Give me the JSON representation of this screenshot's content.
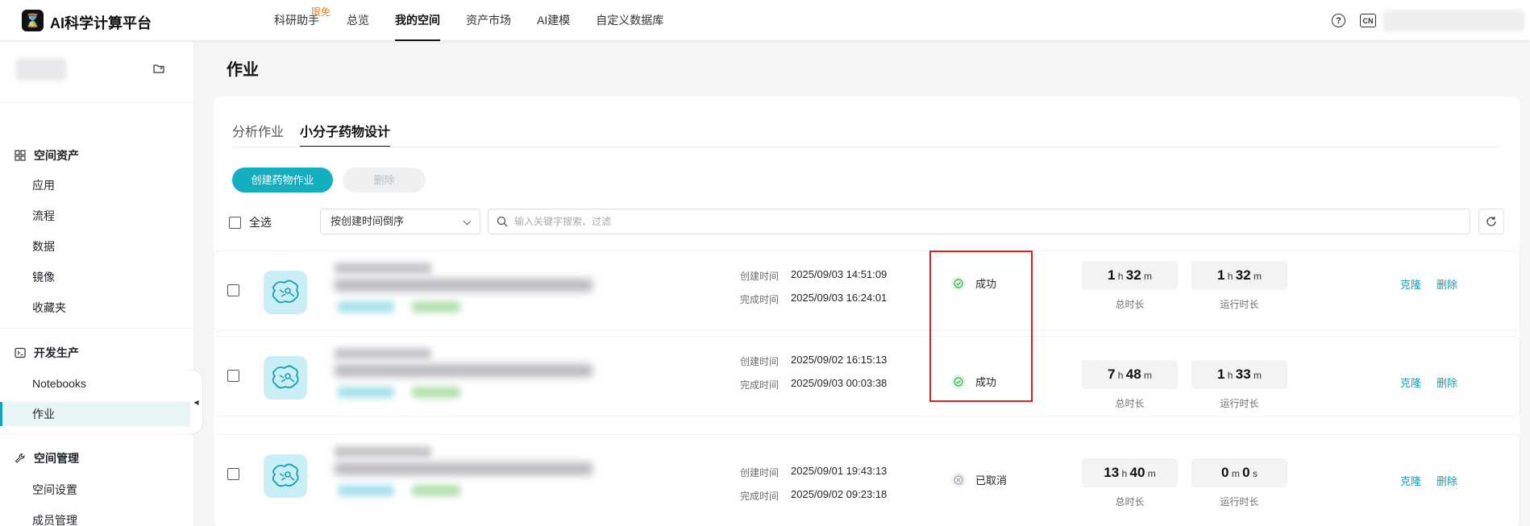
{
  "app": {
    "logo_glyph": "⌛",
    "title": "AI科学计算平台"
  },
  "nav": [
    {
      "label": "科研助手",
      "badge": "限免",
      "active": false
    },
    {
      "label": "总览",
      "active": false
    },
    {
      "label": "我的空间",
      "active": true
    },
    {
      "label": "资产市场",
      "active": false
    },
    {
      "label": "AI建模",
      "active": false
    },
    {
      "label": "自定义数据库",
      "active": false
    }
  ],
  "header": {
    "help_glyph": "?",
    "lang": "CN"
  },
  "sidebar": {
    "groups": [
      {
        "label": "空间资产",
        "icon": "grid-icon",
        "items": [
          "应用",
          "流程",
          "数据",
          "镜像",
          "收藏夹"
        ]
      },
      {
        "label": "开发生产",
        "icon": "terminal-icon",
        "items": [
          "Notebooks",
          "作业"
        ]
      },
      {
        "label": "空间管理",
        "icon": "wrench-icon",
        "items": [
          "空间设置",
          "成员管理"
        ]
      }
    ],
    "active_item": "作业"
  },
  "page": {
    "title": "作业"
  },
  "tabs": [
    {
      "label": "分析作业",
      "active": false
    },
    {
      "label": "小分子药物设计",
      "active": true
    }
  ],
  "toolbar": {
    "create_label": "创建药物作业",
    "delete_label": "删除",
    "select_all_label": "全选",
    "sort_value": "按创建时间倒序",
    "search_placeholder": "输入关键字搜索、过滤"
  },
  "labels": {
    "created": "创建时间",
    "finished": "完成时间",
    "total_duration": "总时长",
    "run_duration": "运行时长",
    "clone": "克隆",
    "delete": "删除"
  },
  "jobs": [
    {
      "created": "2025/09/03 14:51:09",
      "finished": "2025/09/03 16:24:01",
      "status": "成功",
      "status_kind": "success",
      "total": {
        "h": "1",
        "m": "32"
      },
      "run": {
        "h": "1",
        "m": "32"
      }
    },
    {
      "created": "2025/09/02 16:15:13",
      "finished": "2025/09/03 00:03:38",
      "status": "成功",
      "status_kind": "success",
      "total": {
        "h": "7",
        "m": "48"
      },
      "run": {
        "h": "1",
        "m": "33"
      }
    },
    {
      "created": "2025/09/01 19:43:13",
      "finished": "2025/09/02 09:23:18",
      "status": "已取消",
      "status_kind": "cancelled",
      "total": {
        "h": "13",
        "m": "40"
      },
      "run": {
        "m": "0",
        "s": "0"
      }
    }
  ],
  "colors": {
    "accent": "#14aebf",
    "success": "#2fb344",
    "highlight": "#e02020"
  }
}
